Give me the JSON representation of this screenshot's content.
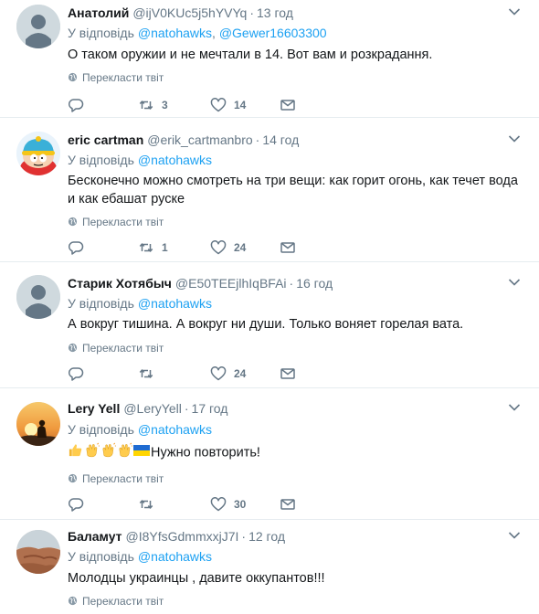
{
  "ui": {
    "reply_prefix": "У відповідь",
    "translate_label": "Перекласти твіт",
    "icons": {
      "reply": "reply-icon",
      "retweet": "retweet-icon",
      "like": "heart-icon",
      "dm": "envelope-icon",
      "translate": "globe-icon",
      "more": "chevron-down-icon"
    },
    "colors": {
      "link": "#1da1f2",
      "muted": "#657786",
      "divider": "#e6ecf0",
      "text": "#14171a"
    }
  },
  "tweets": [
    {
      "name": "Анатолий",
      "handle": "@ijV0KUc5j5hYVYq",
      "time": "13 год",
      "reply_to": [
        "@natohawks",
        "@Gewer16603300"
      ],
      "text": "О таком оружии и не мечтали в 14. Вот вам и розкрадання.",
      "retweets": "3",
      "likes": "14",
      "avatar": "default-avatar"
    },
    {
      "name": "eric cartman",
      "handle": "@erik_cartmanbro",
      "time": "14 год",
      "reply_to": [
        "@natohawks"
      ],
      "text": "Бесконечно можно смотреть на три вещи: как горит огонь, как течет вода и как ебашат руске",
      "retweets": "1",
      "likes": "24",
      "avatar": "cartman-avatar"
    },
    {
      "name": "Старик Хотябыч",
      "handle": "@E50TEEjlhIqBFAi",
      "time": "16 год",
      "reply_to": [
        "@natohawks"
      ],
      "text": "А вокруг тишина. А вокруг ни души. Только воняет горелая вата.",
      "retweets": "",
      "likes": "24",
      "avatar": "default-avatar"
    },
    {
      "name": "Lery Yell",
      "handle": "@LeryYell",
      "time": "17 год",
      "reply_to": [
        "@natohawks"
      ],
      "emoji": [
        "thumbs-up",
        "clapping-hands",
        "clapping-hands",
        "clapping-hands",
        "ukraine-flag"
      ],
      "text": "Нужно повторить!",
      "retweets": "",
      "likes": "30",
      "avatar": "sunset-avatar"
    },
    {
      "name": "Баламут",
      "handle": "@I8YfsGdmmxxjJ7I",
      "time": "12 год",
      "reply_to": [
        "@natohawks"
      ],
      "text": "Молодцы украинцы , давите оккупантов!!!",
      "retweets": "",
      "likes": "",
      "avatar": "landscape-avatar"
    }
  ]
}
